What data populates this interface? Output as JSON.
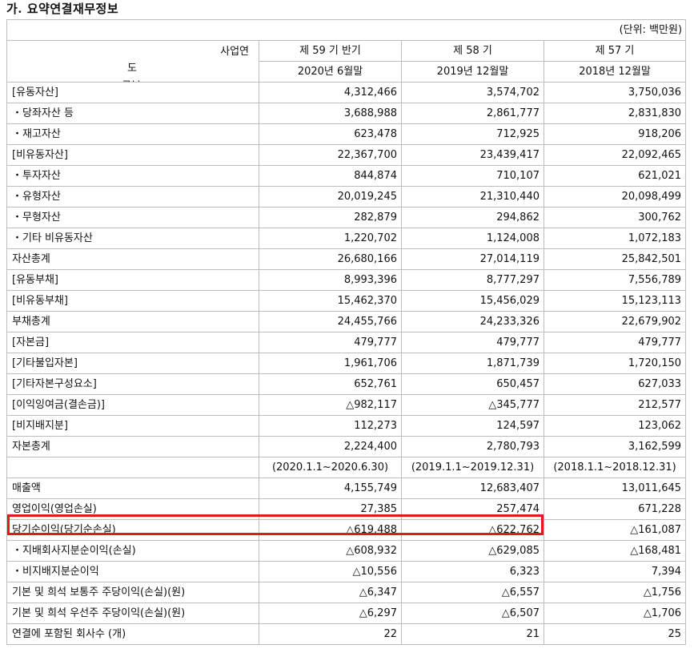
{
  "heading": "가. 요약연결재무정보",
  "unit": "(단위: 백만원)",
  "header": {
    "corner_top": "사업연",
    "corner_mid": "도",
    "corner_bottom": "구분",
    "periods": [
      "제 59 기 반기",
      "제 58 기",
      "제 57 기"
    ],
    "dates": [
      "2020년 6월말",
      "2019년 12월말",
      "2018년 12월말"
    ]
  },
  "balance_rows": [
    {
      "label": "[유동자산]",
      "values": [
        "4,312,466",
        "3,574,702",
        "3,750,036"
      ]
    },
    {
      "label": "・당좌자산 등",
      "values": [
        "3,688,988",
        "2,861,777",
        "2,831,830"
      ]
    },
    {
      "label": "・재고자산",
      "values": [
        "623,478",
        "712,925",
        "918,206"
      ]
    },
    {
      "label": "[비유동자산]",
      "values": [
        "22,367,700",
        "23,439,417",
        "22,092,465"
      ]
    },
    {
      "label": "・투자자산",
      "values": [
        "844,874",
        "710,107",
        "621,021"
      ]
    },
    {
      "label": "・유형자산",
      "values": [
        "20,019,245",
        "21,310,440",
        "20,098,499"
      ]
    },
    {
      "label": "・무형자산",
      "values": [
        "282,879",
        "294,862",
        "300,762"
      ]
    },
    {
      "label": "・기타 비유동자산",
      "values": [
        "1,220,702",
        "1,124,008",
        "1,072,183"
      ]
    },
    {
      "label": "자산총계",
      "values": [
        "26,680,166",
        "27,014,119",
        "25,842,501"
      ]
    },
    {
      "label": "[유동부채]",
      "values": [
        "8,993,396",
        "8,777,297",
        "7,556,789"
      ]
    },
    {
      "label": "[비유동부채]",
      "values": [
        "15,462,370",
        "15,456,029",
        "15,123,113"
      ]
    },
    {
      "label": "부채총계",
      "values": [
        "24,455,766",
        "24,233,326",
        "22,679,902"
      ]
    },
    {
      "label": "[자본금]",
      "values": [
        "479,777",
        "479,777",
        "479,777"
      ]
    },
    {
      "label": "[기타불입자본]",
      "values": [
        "1,961,706",
        "1,871,739",
        "1,720,150"
      ]
    },
    {
      "label": "[기타자본구성요소]",
      "values": [
        "652,761",
        "650,457",
        "627,033"
      ]
    },
    {
      "label": "[이익잉여금(결손금)]",
      "values": [
        "△982,117",
        "△345,777",
        "212,577"
      ]
    },
    {
      "label": "[비지배지분]",
      "values": [
        "112,273",
        "124,597",
        "123,062"
      ]
    },
    {
      "label": "자본총계",
      "values": [
        "2,224,400",
        "2,780,793",
        "3,162,599"
      ]
    }
  ],
  "income_periods": [
    "(2020.1.1~2020.6.30)",
    "(2019.1.1~2019.12.31)",
    "(2018.1.1~2018.12.31)"
  ],
  "income_rows": [
    {
      "label": "매출액",
      "values": [
        "4,155,749",
        "12,683,407",
        "13,011,645"
      ]
    },
    {
      "label": "영업이익(영업손실)",
      "values": [
        "27,385",
        "257,474",
        "671,228"
      ]
    },
    {
      "label": "당기순이익(당기순손실)",
      "values": [
        "△619,488",
        "△622,762",
        "△161,087"
      ]
    },
    {
      "label": "・지배회사지분순이익(손실)",
      "values": [
        "△608,932",
        "△629,085",
        "△168,481"
      ]
    },
    {
      "label": "・비지배지분순이익",
      "values": [
        "△10,556",
        "6,323",
        "7,394"
      ]
    },
    {
      "label": "기본 및 희석 보통주 주당이익(손실)(원)",
      "values": [
        "△6,347",
        "△6,557",
        "△1,756"
      ]
    },
    {
      "label": "기본 및 희석 우선주 주당이익(손실)(원)",
      "values": [
        "△6,297",
        "△6,507",
        "△1,706"
      ]
    },
    {
      "label": "연결에 포함된 회사수 (개)",
      "values": [
        "22",
        "21",
        "25"
      ]
    }
  ],
  "highlight_color": "#e0181f"
}
